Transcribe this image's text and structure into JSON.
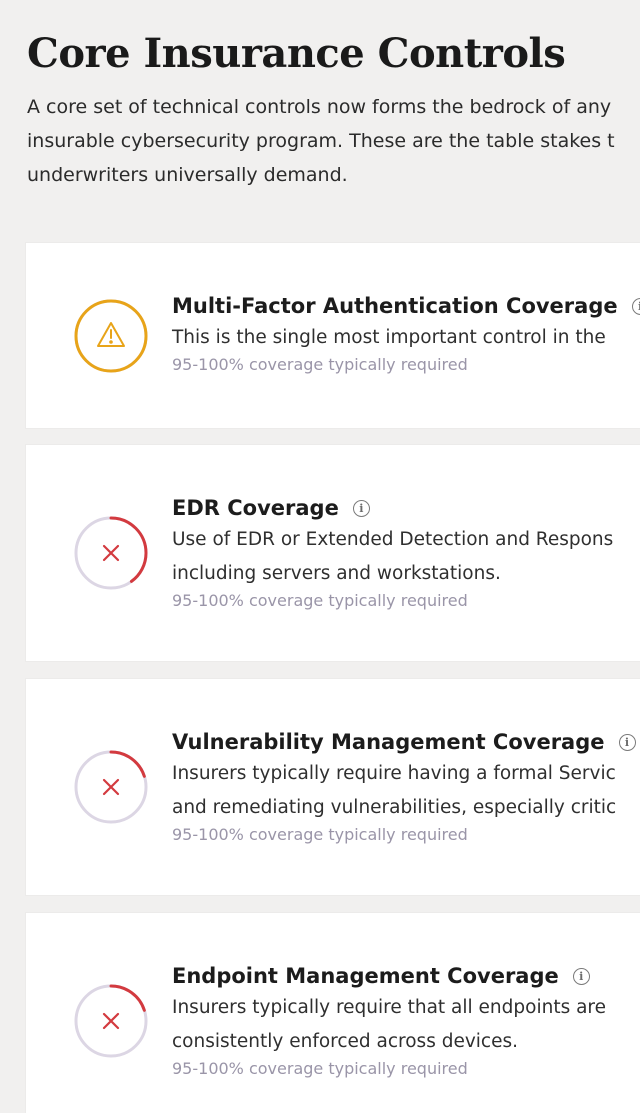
{
  "page": {
    "title": "Core Insurance Controls",
    "intro_lines": [
      "A core set of technical controls now forms the bedrock of any",
      "insurable cybersecurity program. These are the table stakes t",
      "underwriters universally demand."
    ]
  },
  "colors": {
    "warning": "#e8a419",
    "error": "#d33a3f",
    "track": "#dcd6e4"
  },
  "controls": [
    {
      "status": "warning",
      "status_icon": "warning-triangle-icon",
      "level": 1.0,
      "title": "Multi-Factor Authentication Coverage",
      "description_lines": [
        "This is the single most important control in the"
      ],
      "requirement": "95-100% coverage typically required"
    },
    {
      "status": "error",
      "status_icon": "x-icon",
      "level": 0.4,
      "title": "EDR Coverage",
      "description_lines": [
        "Use of EDR or Extended Detection and Respons",
        "including servers and workstations."
      ],
      "requirement": "95-100% coverage typically required"
    },
    {
      "status": "error",
      "status_icon": "x-icon",
      "level": 0.2,
      "title": "Vulnerability Management Coverage",
      "description_lines": [
        "Insurers typically require having a formal Servic",
        "and remediating vulnerabilities, especially critic"
      ],
      "requirement": "95-100% coverage typically required"
    },
    {
      "status": "error",
      "status_icon": "x-icon",
      "level": 0.2,
      "title": "Endpoint Management Coverage",
      "description_lines": [
        "Insurers typically require that all endpoints are",
        "consistently enforced across devices."
      ],
      "requirement": "95-100% coverage typically required"
    }
  ]
}
